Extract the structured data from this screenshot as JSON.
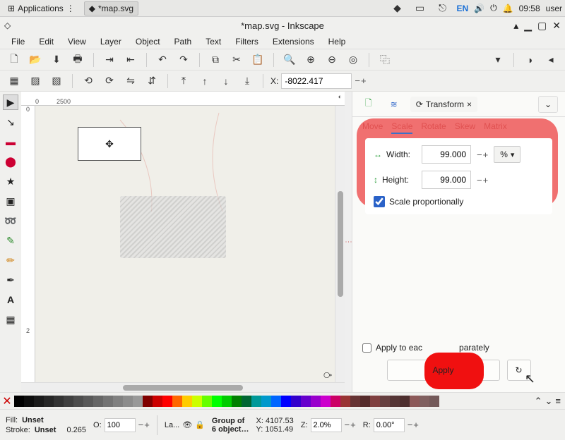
{
  "taskbar": {
    "apps_label": "Applications",
    "tab_label": "*map.svg",
    "lang": "EN",
    "time": "09:58",
    "user": "user"
  },
  "window": {
    "title": "*map.svg - Inkscape"
  },
  "menu": {
    "file": "File",
    "edit": "Edit",
    "view": "View",
    "layer": "Layer",
    "object": "Object",
    "path": "Path",
    "text": "Text",
    "filters": "Filters",
    "extensions": "Extensions",
    "help": "Help"
  },
  "toolbar2": {
    "x_label": "X:",
    "x_value": "-8022.417"
  },
  "ruler": {
    "h0": "0",
    "h2500": "2500",
    "v0": "0",
    "v2": "2"
  },
  "panel": {
    "tab_new": "",
    "tab_layers": "",
    "tab_transform": "Transform",
    "sub": {
      "move": "Move",
      "scale": "Scale",
      "rotate": "Rotate",
      "skew": "Skew",
      "matrix": "Matrix"
    },
    "width_label": "Width:",
    "width_value": "99.000",
    "height_label": "Height:",
    "height_value": "99.000",
    "unit": "%",
    "scale_prop": "Scale proportionally",
    "apply_each_pre": "Apply to eac",
    "apply_each_post": "parately",
    "apply_btn": "Apply"
  },
  "status": {
    "fill_label": "Fill:",
    "fill_value": "Unset",
    "stroke_label": "Stroke:",
    "stroke_value": "Unset",
    "opacity_label": "O:",
    "opacity_value": "100",
    "stroke_w": "0.265",
    "layer_short": "La...",
    "group_l1": "Group of",
    "group_l2": "6 object…",
    "x_label": "X:",
    "x_val": "4107.53",
    "y_label": "Y:",
    "y_val": "1051.49",
    "z_label": "Z:",
    "z_val": "2.0%",
    "r_label": "R:",
    "r_val": "0.00°"
  },
  "palette": {
    "grays": [
      "#000000",
      "#0d0d0d",
      "#1a1a1a",
      "#262626",
      "#333333",
      "#404040",
      "#4d4d4d",
      "#595959",
      "#666666",
      "#737373",
      "#808080",
      "#8c8c8c",
      "#999999"
    ],
    "colors": [
      "#800000",
      "#cc0000",
      "#ff0000",
      "#ff6600",
      "#ffcc00",
      "#ccff00",
      "#66ff00",
      "#00ff00",
      "#00cc00",
      "#008000",
      "#006633",
      "#009999",
      "#0099cc",
      "#0066ff",
      "#0000ff",
      "#3300cc",
      "#6600cc",
      "#9900cc",
      "#cc00cc",
      "#cc0066",
      "#993333",
      "#663333",
      "#552b2b",
      "#804040",
      "#664040",
      "#553535",
      "#4d2e2e",
      "#8c5959",
      "#806060",
      "#735959"
    ]
  }
}
